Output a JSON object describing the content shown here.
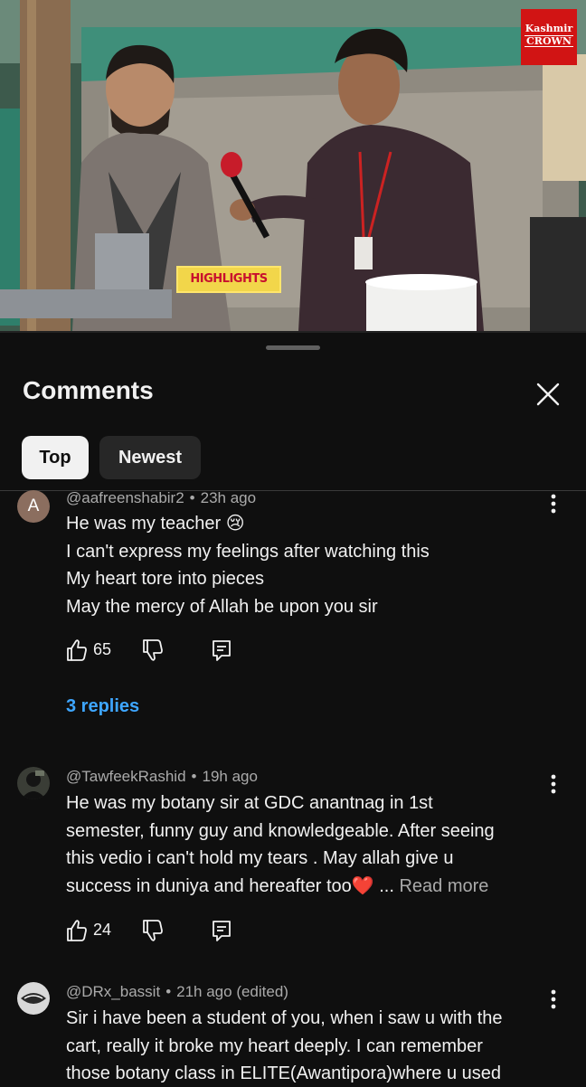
{
  "video": {
    "brand_line1": "Kashmir",
    "brand_line2": "CROWN",
    "overlay_label": "HIGHLIGHTS",
    "brand_color": "#d11414"
  },
  "sheet": {
    "title": "Comments",
    "close_icon": "close-icon",
    "sort_chips": [
      {
        "label": "Top",
        "selected": true
      },
      {
        "label": "Newest",
        "selected": false
      }
    ]
  },
  "comments": [
    {
      "avatar_letter": "A",
      "author": "@aafreenshabir2",
      "time": "23h ago",
      "lines": [
        "He was my teacher 😢",
        "I can't express my feelings after watching this",
        "My heart tore into pieces",
        "May the mercy of Allah be upon you sir"
      ],
      "likes": "65",
      "replies_label": "3 replies"
    },
    {
      "author": "@TawfeekRashid",
      "time": "19h ago",
      "lines": [
        "He was my botany sir at GDC anantnag in 1st",
        "semester, funny guy and knowledgeable. After seeing",
        "this vedio i can't hold my tears . May allah give u",
        "success in duniya and hereafter too❤️ ..."
      ],
      "read_more": "Read more",
      "likes": "24"
    },
    {
      "author": "@DRx_bassit",
      "time": "21h ago (edited)",
      "lines": [
        "Sir i have been a student of you, when i saw u with the",
        "cart, really it broke my heart deeply. I can remember",
        "those botany class in ELITE(Awantipora)where u used"
      ]
    }
  ],
  "colors": {
    "background": "#0f0f0f",
    "text_primary": "#f1f1f1",
    "text_secondary": "#aaaaaa",
    "link": "#3ea6ff",
    "chip_selected_bg": "#f1f1f1",
    "chip_bg": "#272727"
  }
}
